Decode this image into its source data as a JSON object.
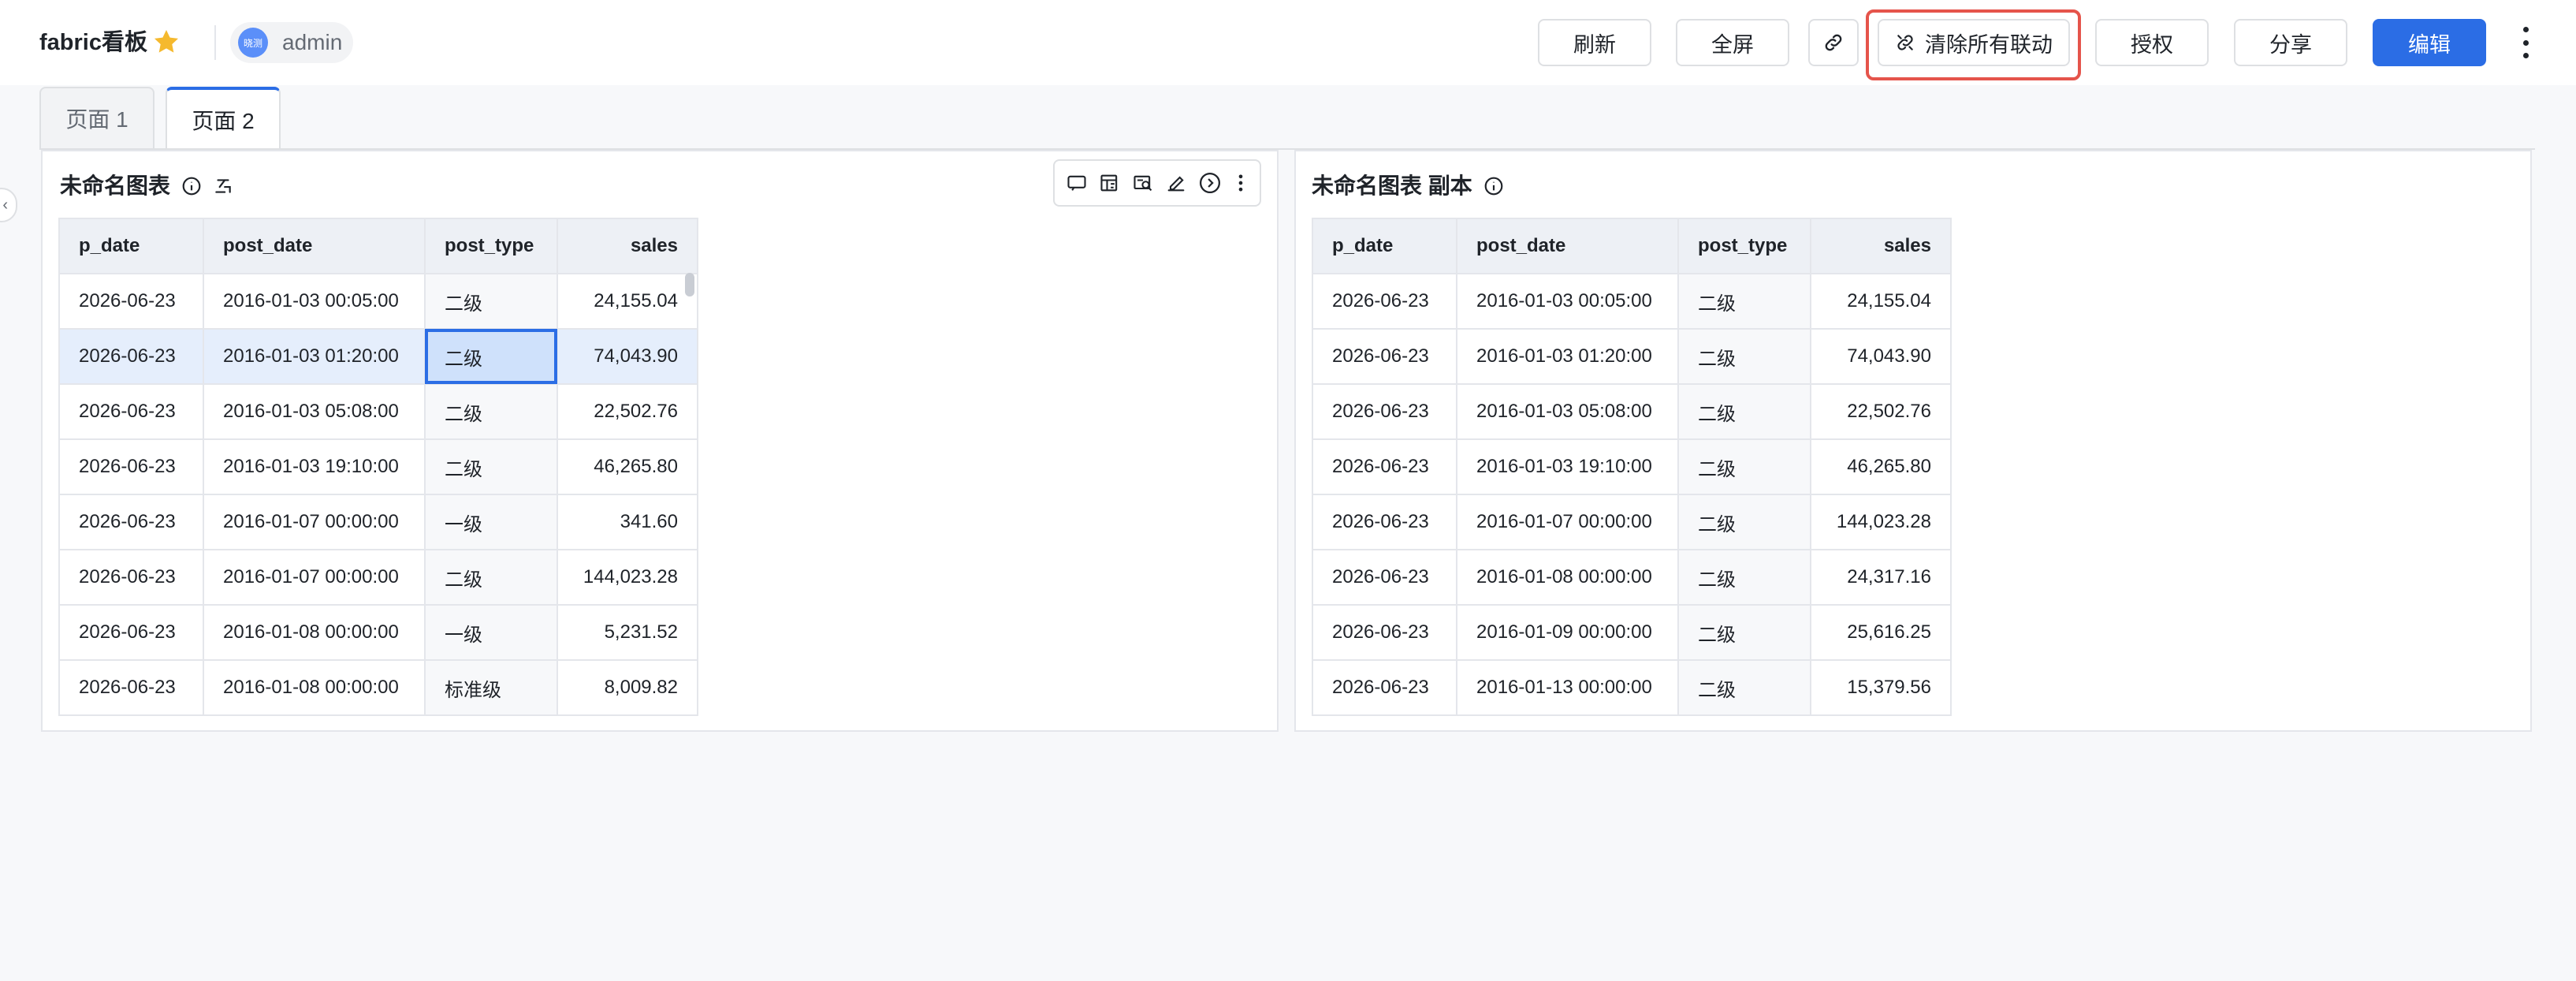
{
  "header": {
    "title": "fabric看板",
    "user": {
      "avatar_text": "晓测",
      "name": "admin"
    },
    "buttons": {
      "refresh": "刷新",
      "fullscreen": "全屏",
      "clear_links": "清除所有联动",
      "authorize": "授权",
      "share": "分享",
      "edit": "编辑"
    }
  },
  "tabs": [
    {
      "label": "页面 1",
      "active": false
    },
    {
      "label": "页面 2",
      "active": true
    }
  ],
  "panels": [
    {
      "title": "未命名图表",
      "columns": [
        "p_date",
        "post_date",
        "post_type",
        "sales"
      ],
      "rows": [
        [
          "2026-06-23",
          "2016-01-03 00:05:00",
          "二级",
          "24,155.04"
        ],
        [
          "2026-06-23",
          "2016-01-03 01:20:00",
          "二级",
          "74,043.90"
        ],
        [
          "2026-06-23",
          "2016-01-03 05:08:00",
          "二级",
          "22,502.76"
        ],
        [
          "2026-06-23",
          "2016-01-03 19:10:00",
          "二级",
          "46,265.80"
        ],
        [
          "2026-06-23",
          "2016-01-07 00:00:00",
          "一级",
          "341.60"
        ],
        [
          "2026-06-23",
          "2016-01-07 00:00:00",
          "二级",
          "144,023.28"
        ],
        [
          "2026-06-23",
          "2016-01-08 00:00:00",
          "一级",
          "5,231.52"
        ],
        [
          "2026-06-23",
          "2016-01-08 00:00:00",
          "标准级",
          "8,009.82"
        ]
      ]
    },
    {
      "title": "未命名图表 副本",
      "columns": [
        "p_date",
        "post_date",
        "post_type",
        "sales"
      ],
      "rows": [
        [
          "2026-06-23",
          "2016-01-03 00:05:00",
          "二级",
          "24,155.04"
        ],
        [
          "2026-06-23",
          "2016-01-03 01:20:00",
          "二级",
          "74,043.90"
        ],
        [
          "2026-06-23",
          "2016-01-03 05:08:00",
          "二级",
          "22,502.76"
        ],
        [
          "2026-06-23",
          "2016-01-03 19:10:00",
          "二级",
          "46,265.80"
        ],
        [
          "2026-06-23",
          "2016-01-07 00:00:00",
          "二级",
          "144,023.28"
        ],
        [
          "2026-06-23",
          "2016-01-08 00:00:00",
          "二级",
          "24,317.16"
        ],
        [
          "2026-06-23",
          "2016-01-09 00:00:00",
          "二级",
          "25,616.25"
        ],
        [
          "2026-06-23",
          "2016-01-13 00:00:00",
          "二级",
          "15,379.56"
        ]
      ]
    }
  ],
  "colors": {
    "accent": "#2b6de5",
    "highlight": "#e5544b",
    "star": "#f5b92e"
  }
}
